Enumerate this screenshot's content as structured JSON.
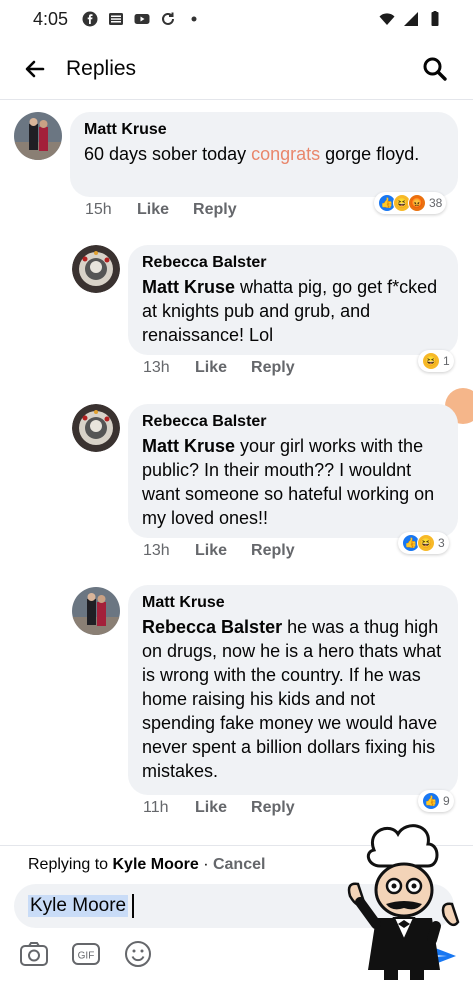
{
  "status_bar": {
    "time": "4:05"
  },
  "header": {
    "title": "Replies"
  },
  "comments": [
    {
      "author": "Matt Kruse",
      "text_plain": "60 days sober today ",
      "text_highlight": "congrats",
      "text_tail": " gorge floyd.",
      "time": "15h",
      "like_label": "Like",
      "reply_label": "Reply",
      "reaction_count": "38"
    },
    {
      "author": "Rebecca Balster",
      "mention": "Matt Kruse",
      "text": " whatta pig, go get f*cked at knights pub and grub, and renaissance! Lol",
      "time": "13h",
      "like_label": "Like",
      "reply_label": "Reply",
      "reaction_count": "1"
    },
    {
      "author": "Rebecca Balster",
      "mention": "Matt Kruse",
      "text": " your girl works with the public? In their mouth?? I wouldnt want someone so hateful working on my loved ones!!",
      "time": "13h",
      "like_label": "Like",
      "reply_label": "Reply",
      "reaction_count": "3"
    },
    {
      "author": "Matt Kruse",
      "mention": "Rebecca Balster",
      "text": " he was a thug high on drugs, now he is a hero thats what is wrong with the country. If he was home raising his kids and not spending fake money we would have never spent a billion dollars fixing his mistakes.",
      "time": "11h",
      "like_label": "Like",
      "reply_label": "Reply",
      "reaction_count": "9"
    }
  ],
  "composer": {
    "replying_prefix": "Replying to ",
    "replying_to": "Kyle Moore",
    "separator": " · ",
    "cancel_label": "Cancel",
    "input_value": "Kyle Moore"
  },
  "colors": {
    "bubble": "#f0f2f5",
    "highlight": "#e9866b",
    "like_blue": "#1877f2",
    "haha_yellow": "#f7b928",
    "angry_orange": "#e9710f"
  }
}
